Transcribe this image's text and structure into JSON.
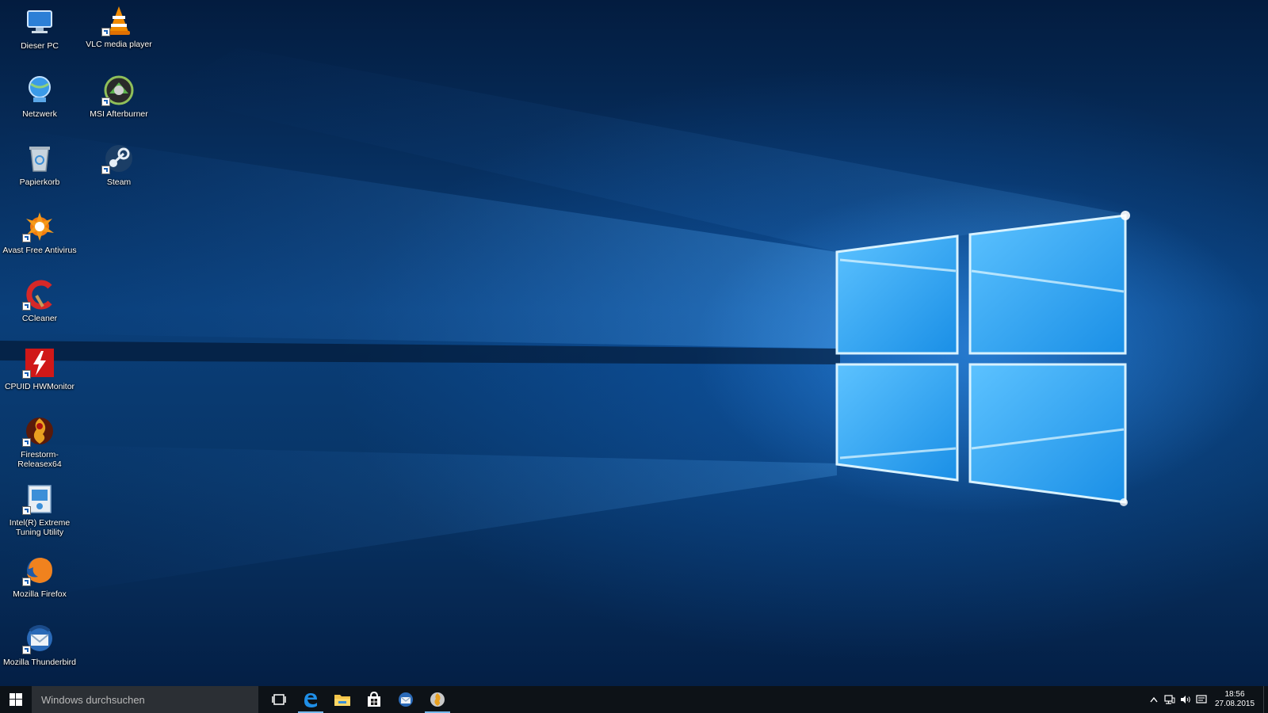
{
  "desktop": {
    "icons": [
      {
        "label": "Dieser PC",
        "icon": "computer-icon"
      },
      {
        "label": "VLC media player",
        "icon": "vlc-cone-icon"
      },
      {
        "label": "Netzwerk",
        "icon": "network-icon"
      },
      {
        "label": "MSI Afterburner",
        "icon": "msi-afterburner-icon"
      },
      {
        "label": "Papierkorb",
        "icon": "recycle-bin-icon"
      },
      {
        "label": "Steam",
        "icon": "steam-icon"
      },
      {
        "label": "Avast Free Antivirus",
        "icon": "avast-icon"
      },
      {
        "label": "CCleaner",
        "icon": "ccleaner-icon"
      },
      {
        "label": "CPUID HWMonitor",
        "icon": "hwmonitor-icon"
      },
      {
        "label": "Firestorm-Releasex64",
        "icon": "firestorm-icon"
      },
      {
        "label": "Intel(R) Extreme Tuning Utility",
        "icon": "intel-xtu-icon"
      },
      {
        "label": "Mozilla Firefox",
        "icon": "firefox-icon"
      },
      {
        "label": "Mozilla Thunderbird",
        "icon": "thunderbird-icon"
      }
    ]
  },
  "taskbar": {
    "search_placeholder": "Windows durchsuchen",
    "apps": [
      {
        "name": "Task View",
        "icon": "task-view-icon"
      },
      {
        "name": "Microsoft Edge",
        "icon": "edge-icon",
        "active": true
      },
      {
        "name": "Explorer",
        "icon": "folder-icon"
      },
      {
        "name": "Store",
        "icon": "store-icon"
      },
      {
        "name": "Thunderbird",
        "icon": "thunderbird-icon"
      },
      {
        "name": "Firestorm",
        "icon": "firestorm-icon",
        "active": true
      }
    ],
    "tray": {
      "icons": [
        "chevron-up-icon",
        "network-icon",
        "volume-icon",
        "action-center-icon"
      ],
      "time": "18:56",
      "date": "27.08.2015"
    }
  },
  "colors": {
    "taskbar_bg": "#0d1217",
    "search_bg": "#2b2f34",
    "accent": "#76b9ed"
  }
}
